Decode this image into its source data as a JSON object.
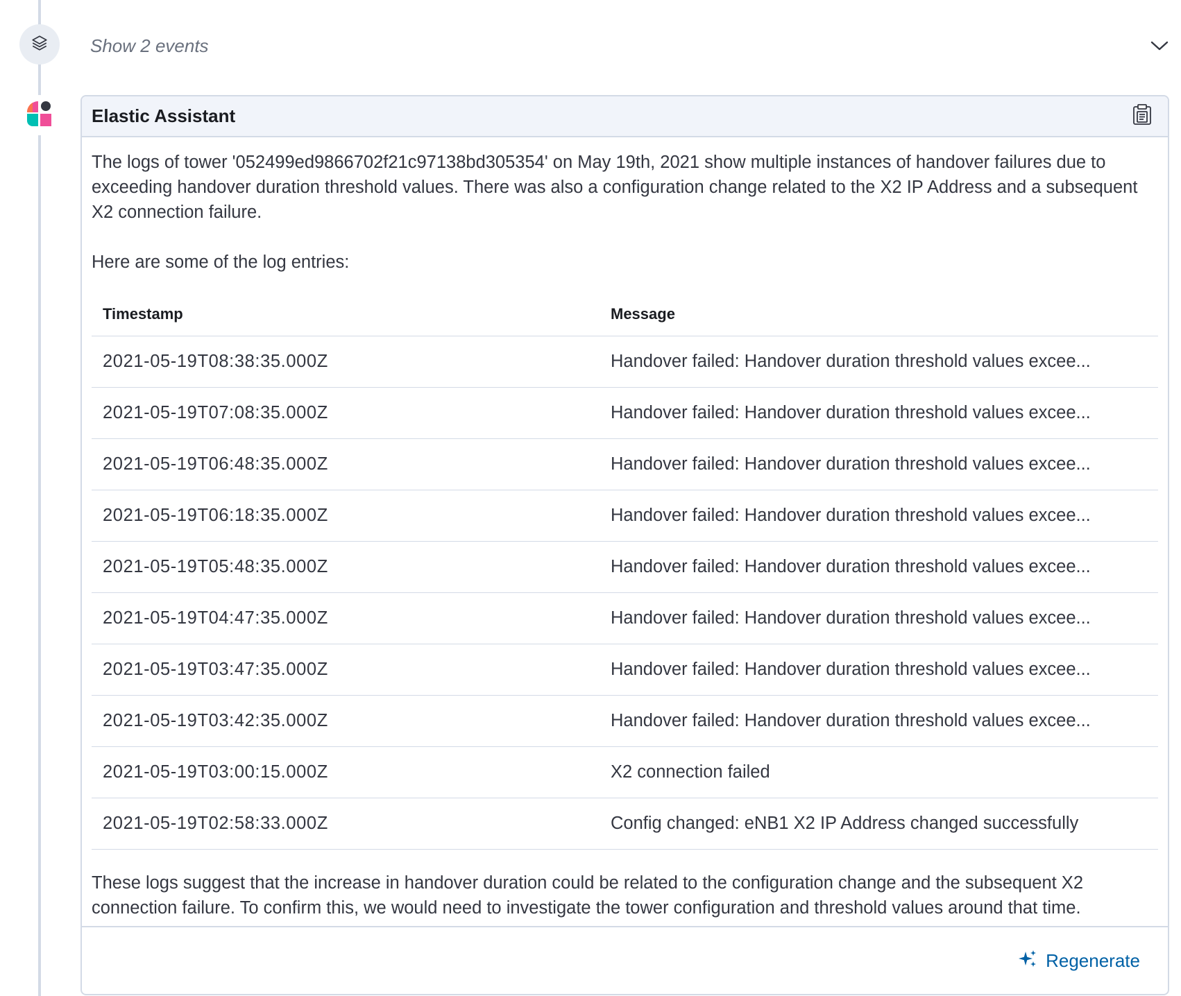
{
  "events": {
    "label": "Show 2 events"
  },
  "message": {
    "author": "Elastic Assistant",
    "intro": "The logs of tower '052499ed9866702f21c97138bd305354' on May 19th, 2021 show multiple instances of handover failures due to exceeding handover duration threshold values. There was also a configuration change related to the X2 IP Address and a subsequent X2 connection failure.",
    "lead_in": "Here are some of the log entries:",
    "table": {
      "headers": [
        "Timestamp",
        "Message"
      ],
      "rows": [
        [
          "2021-05-19T08:38:35.000Z",
          "Handover failed: Handover duration threshold values excee..."
        ],
        [
          "2021-05-19T07:08:35.000Z",
          "Handover failed: Handover duration threshold values excee..."
        ],
        [
          "2021-05-19T06:48:35.000Z",
          "Handover failed: Handover duration threshold values excee..."
        ],
        [
          "2021-05-19T06:18:35.000Z",
          "Handover failed: Handover duration threshold values excee..."
        ],
        [
          "2021-05-19T05:48:35.000Z",
          "Handover failed: Handover duration threshold values excee..."
        ],
        [
          "2021-05-19T04:47:35.000Z",
          "Handover failed: Handover duration threshold values excee..."
        ],
        [
          "2021-05-19T03:47:35.000Z",
          "Handover failed: Handover duration threshold values excee..."
        ],
        [
          "2021-05-19T03:42:35.000Z",
          "Handover failed: Handover duration threshold values excee..."
        ],
        [
          "2021-05-19T03:00:15.000Z",
          "X2 connection failed"
        ],
        [
          "2021-05-19T02:58:33.000Z",
          "Config changed: eNB1 X2 IP Address changed successfully"
        ]
      ]
    },
    "closing": "These logs suggest that the increase in handover duration could be related to the configuration change and the subsequent X2 connection failure. To confirm this, we would need to investigate the tower configuration and threshold values around that time."
  },
  "footer": {
    "regenerate_label": "Regenerate"
  },
  "icons": {
    "events": "layers-icon",
    "expand": "chevron-down-icon",
    "avatar": "elastic-logo-icon",
    "copy": "clipboard-icon",
    "regenerate": "sparkles-icon"
  },
  "colors": {
    "link": "#0061a6",
    "rail": "#d3dae6",
    "header_bg": "#f1f4fa",
    "muted_text": "#69707d"
  }
}
